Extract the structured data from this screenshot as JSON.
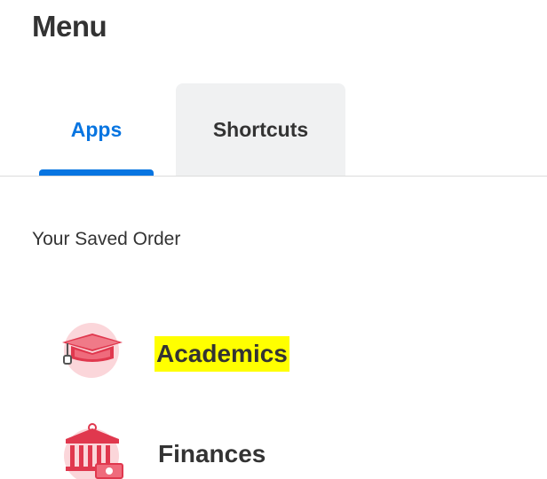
{
  "header": {
    "title": "Menu"
  },
  "tabs": [
    {
      "label": "Apps",
      "selected": true
    },
    {
      "label": "Shortcuts",
      "selected": false
    }
  ],
  "section": {
    "label": "Your Saved Order"
  },
  "apps": [
    {
      "label": "Academics",
      "icon": "graduation-cap-icon",
      "highlighted": true
    },
    {
      "label": "Finances",
      "icon": "bank-money-icon",
      "highlighted": false
    }
  ],
  "colors": {
    "accent": "#0875e1",
    "icon_red": "#e0384e",
    "icon_bg": "#fbd6da",
    "highlight": "#ffff00"
  }
}
